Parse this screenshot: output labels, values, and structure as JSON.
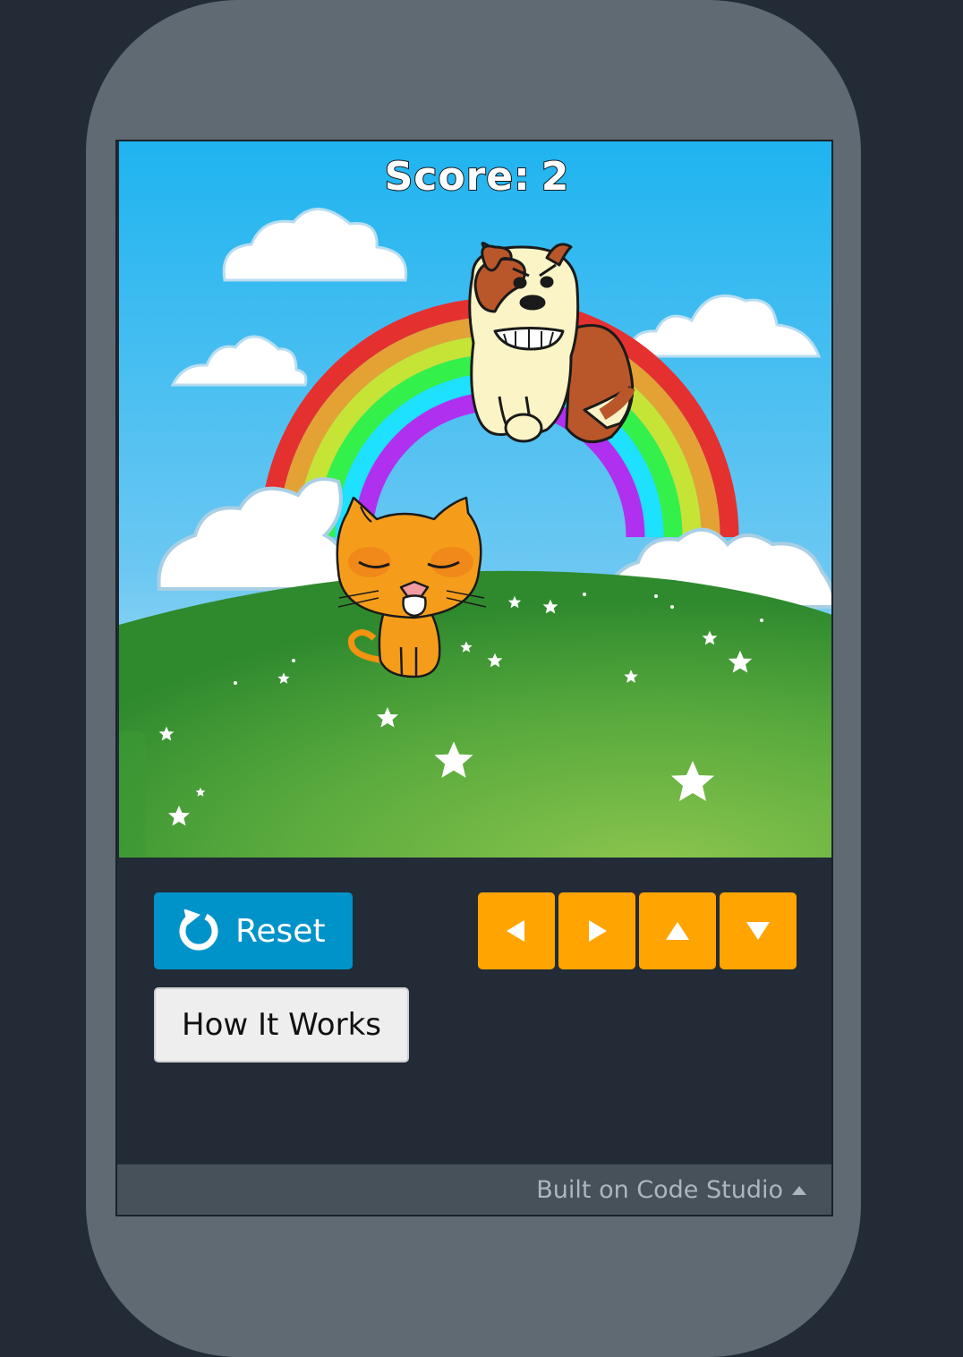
{
  "game": {
    "score_label": "Score:",
    "score_value": "2",
    "characters": [
      "dog",
      "cat"
    ]
  },
  "controls": {
    "reset_label": "Reset",
    "how_label": "How It Works",
    "arrows": [
      "left",
      "right",
      "up",
      "down"
    ]
  },
  "footer": {
    "text": "Built on Code Studio"
  },
  "colors": {
    "background": "#222b36",
    "device_frame": "#5f6a72",
    "reset_button": "#0093c9",
    "arrow_button": "#ffa400",
    "footer_bar": "#465159"
  }
}
